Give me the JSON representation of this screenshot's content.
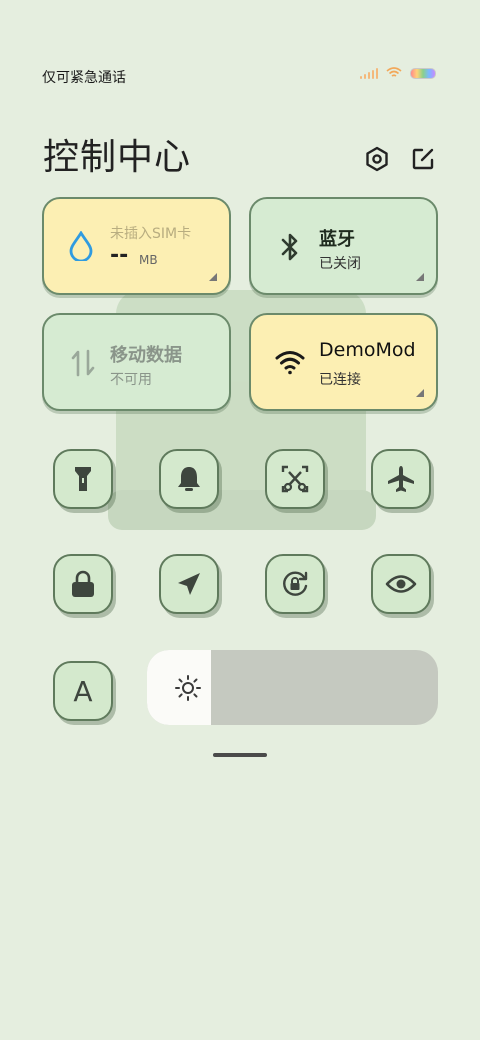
{
  "status_bar": {
    "carrier_text": "仅可紧急通话",
    "wifi_icon": "wifi-icon",
    "battery_icon": "battery-icon"
  },
  "header": {
    "title": "控制中心",
    "settings_icon": "settings-hexagon-icon",
    "edit_icon": "edit-icon"
  },
  "tiles": {
    "data_usage": {
      "label": "未插入SIM卡",
      "value": "--",
      "unit": "MB",
      "icon": "water-drop-icon"
    },
    "bluetooth": {
      "label": "蓝牙",
      "status": "已关闭",
      "icon": "bluetooth-icon"
    },
    "mobile_data": {
      "label": "移动数据",
      "status": "不可用",
      "icon": "data-arrows-icon"
    },
    "wifi": {
      "label": "DemoMod",
      "status": "已连接",
      "icon": "wifi-icon"
    }
  },
  "toggles": [
    {
      "name": "flashlight",
      "icon": "flashlight-icon"
    },
    {
      "name": "ringer",
      "icon": "bell-icon"
    },
    {
      "name": "screenshot",
      "icon": "scissors-screenshot-icon"
    },
    {
      "name": "airplane",
      "icon": "airplane-icon"
    },
    {
      "name": "lock",
      "icon": "lock-icon"
    },
    {
      "name": "location",
      "icon": "location-arrow-icon"
    },
    {
      "name": "rotation-lock",
      "icon": "rotation-lock-icon"
    },
    {
      "name": "reading-mode",
      "icon": "eye-icon"
    },
    {
      "name": "font-auto",
      "icon": "font-a-icon",
      "label": "A"
    }
  ],
  "brightness": {
    "level": 0.22,
    "icon": "sun-icon"
  },
  "colors": {
    "background": "#e5eedf",
    "tile_yellow": "#fcefb3",
    "tile_green": "#d6ebd2",
    "button": "#d4e9cd",
    "accent_blue": "#2f9be0"
  }
}
